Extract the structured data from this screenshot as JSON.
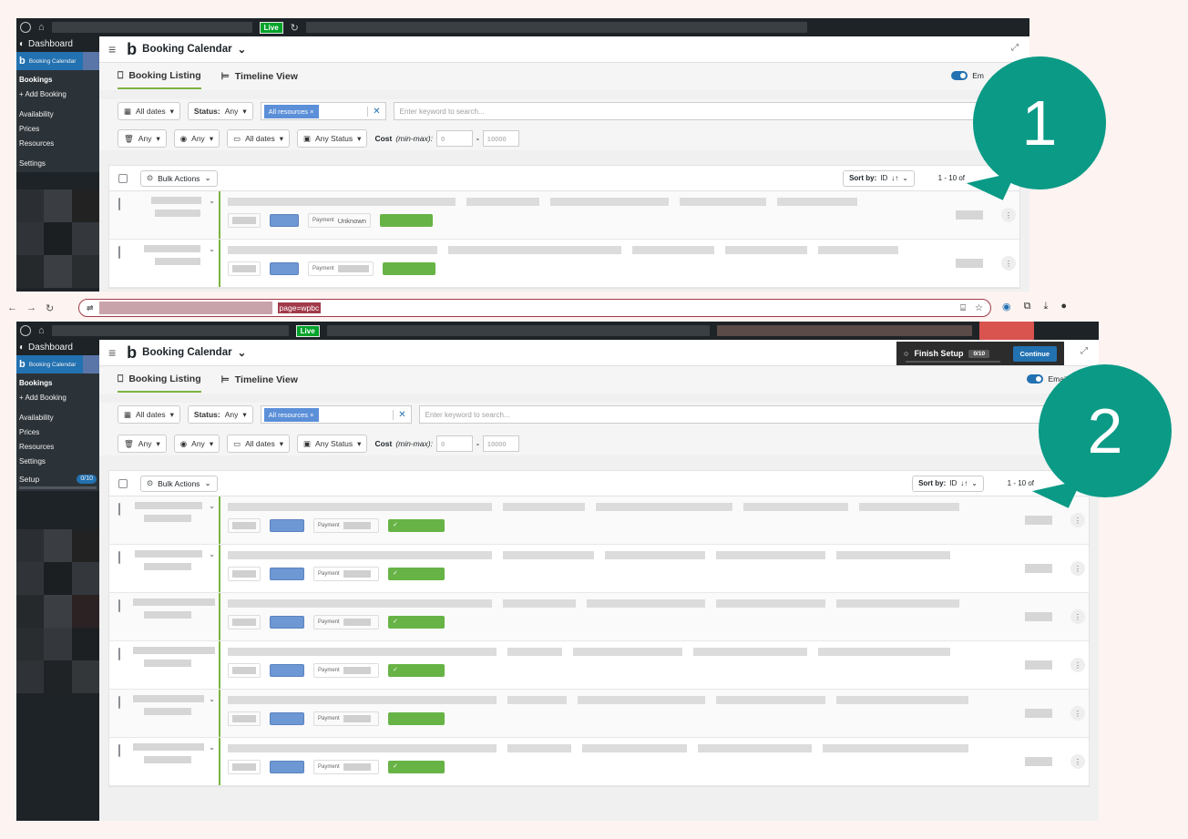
{
  "adminbar": {
    "live": "Live"
  },
  "sidebar": {
    "dashboard": "Dashboard",
    "booking_calendar": "Booking Calendar",
    "items": [
      "Bookings",
      "+ Add Booking",
      "Availability",
      "Prices",
      "Resources",
      "Settings"
    ],
    "setup_label": "Setup",
    "setup_count": "0/10"
  },
  "brand": "Booking Calendar",
  "tabs": [
    "Booking Listing",
    "Timeline View"
  ],
  "emails_label": "Emails",
  "emails_short": "Em",
  "filters": {
    "all_dates": "All dates",
    "status_label": "Status:",
    "status_value": "Any",
    "resources_tag": "All resources",
    "keyword_placeholder": "Enter keyword to search...",
    "any": "Any",
    "any_status": "Any Status",
    "cost_label": "Cost",
    "cost_hint": "(min-max):",
    "cost_min": "0",
    "cost_max": "10000"
  },
  "listing": {
    "bulk_actions": "Bulk Actions",
    "sort_label": "Sort by:",
    "sort_value": "ID",
    "pager": "1 - 10 of",
    "payment": "Payment",
    "unknown": "Unknown"
  },
  "chrome": {
    "url_visible": "page=wpbc"
  },
  "finish_setup": {
    "label": "Finish Setup",
    "count": "0/10",
    "continue": "Continue"
  },
  "bubbles": [
    "1",
    "2"
  ],
  "colors": {
    "accent": "#2271b1",
    "green": "#67b346",
    "bubble": "#0a9a86",
    "adminbar": "#1d2327"
  }
}
